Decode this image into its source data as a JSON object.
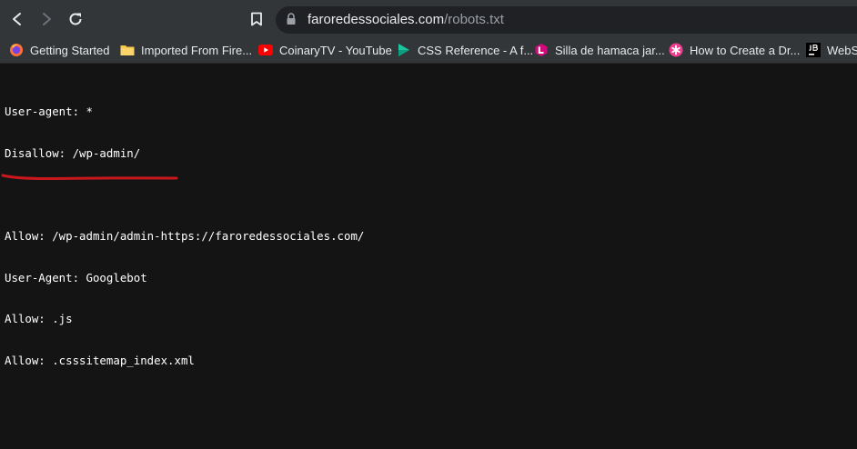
{
  "browser": {
    "url_domain": "faroredessociales.com",
    "url_path": "/robots.txt",
    "icons": {
      "back": "back-arrow-icon",
      "forward": "forward-arrow-icon",
      "reload": "reload-icon",
      "bookmark": "bookmark-icon",
      "lock": "lock-icon"
    }
  },
  "bookmarks": [
    {
      "label": "Getting Started",
      "icon": "firefox-icon"
    },
    {
      "label": "Imported From Fire...",
      "icon": "folder-icon"
    },
    {
      "label": "CoinaryTV - YouTube",
      "icon": "youtube-icon"
    },
    {
      "label": "CSS Reference - A f...",
      "icon": "css-reference-icon"
    },
    {
      "label": "Silla de hamaca jar...",
      "icon": "l-badge-icon"
    },
    {
      "label": "How to Create a Dr...",
      "icon": "asterisk-icon"
    },
    {
      "label": "WebSt",
      "icon": "jetbrains-icon"
    }
  ],
  "robots_txt": {
    "lines": [
      "User-agent: *",
      "Disallow: /wp-admin/",
      "",
      "Allow: /wp-admin/admin-https://faroredessociales.com/",
      "User-Agent: Googlebot",
      "Allow: .js",
      "Allow: .csssitemap_index.xml"
    ],
    "highlight_color": "#c8181e"
  }
}
